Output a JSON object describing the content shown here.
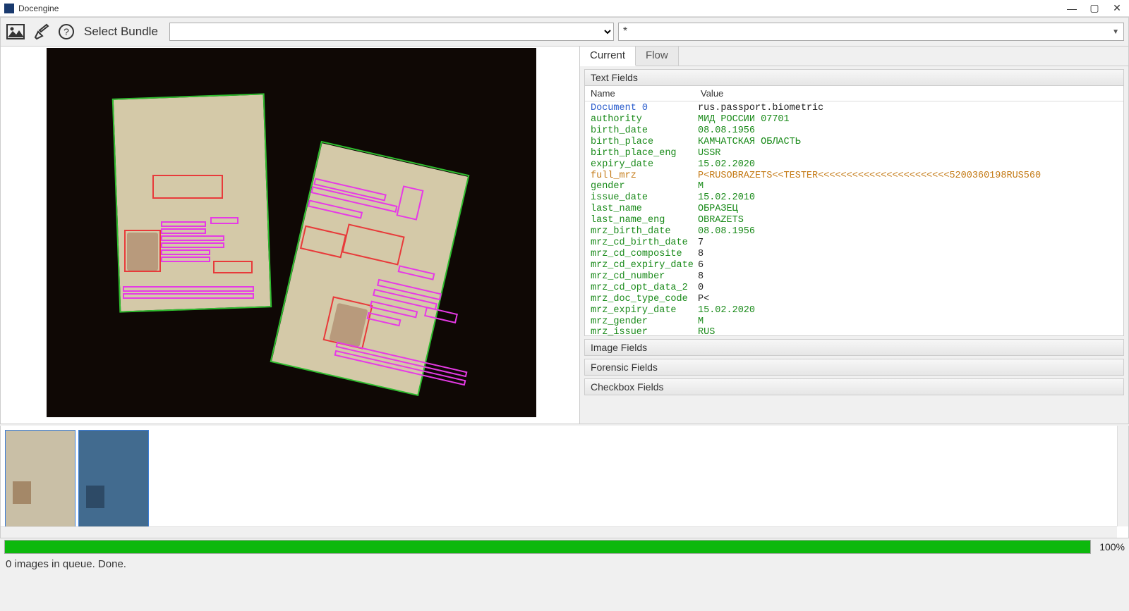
{
  "window": {
    "title": "Docengine"
  },
  "toolbar": {
    "select_bundle_label": "Select Bundle",
    "star_field": "*"
  },
  "tabs": {
    "current": "Current",
    "flow": "Flow"
  },
  "sections": {
    "text_fields": "Text Fields",
    "image_fields": "Image Fields",
    "forensic_fields": "Forensic Fields",
    "checkbox_fields": "Checkbox Fields"
  },
  "columns": {
    "name": "Name",
    "value": "Value"
  },
  "fields": [
    {
      "name": "Document 0",
      "value": "rus.passport.biometric",
      "ncls": "c-doc",
      "vcls": "c-black"
    },
    {
      "name": "authority",
      "value": "МИД РОССИИ 07701",
      "ncls": "c-green",
      "vcls": "c-green"
    },
    {
      "name": "birth_date",
      "value": "08.08.1956",
      "ncls": "c-green",
      "vcls": "c-green"
    },
    {
      "name": "birth_place",
      "value": "КАМЧАТСКАЯ ОБЛАСТЬ",
      "ncls": "c-green",
      "vcls": "c-green"
    },
    {
      "name": "birth_place_eng",
      "value": "USSR",
      "ncls": "c-green",
      "vcls": "c-green"
    },
    {
      "name": "expiry_date",
      "value": "15.02.2020",
      "ncls": "c-green",
      "vcls": "c-green"
    },
    {
      "name": "full_mrz",
      "value": "P<RUSOBRAZETS<<TESTER<<<<<<<<<<<<<<<<<<<<<<<5200360198RUS560",
      "ncls": "c-orange",
      "vcls": "c-orange"
    },
    {
      "name": "gender",
      "value": "M",
      "ncls": "c-green",
      "vcls": "c-green"
    },
    {
      "name": "issue_date",
      "value": "15.02.2010",
      "ncls": "c-green",
      "vcls": "c-green"
    },
    {
      "name": "last_name",
      "value": "ОБРАЗЕЦ",
      "ncls": "c-green",
      "vcls": "c-green"
    },
    {
      "name": "last_name_eng",
      "value": "OBRAZETS",
      "ncls": "c-green",
      "vcls": "c-green"
    },
    {
      "name": "mrz_birth_date",
      "value": "08.08.1956",
      "ncls": "c-green",
      "vcls": "c-green"
    },
    {
      "name": "mrz_cd_birth_date",
      "value": "7",
      "ncls": "c-green",
      "vcls": "c-black"
    },
    {
      "name": "mrz_cd_composite",
      "value": "8",
      "ncls": "c-green",
      "vcls": "c-black"
    },
    {
      "name": "mrz_cd_expiry_date",
      "value": "6",
      "ncls": "c-green",
      "vcls": "c-black"
    },
    {
      "name": "mrz_cd_number",
      "value": "8",
      "ncls": "c-green",
      "vcls": "c-black"
    },
    {
      "name": "mrz_cd_opt_data_2",
      "value": "0",
      "ncls": "c-green",
      "vcls": "c-black"
    },
    {
      "name": "mrz_doc_type_code",
      "value": "P<",
      "ncls": "c-green",
      "vcls": "c-black"
    },
    {
      "name": "mrz_expiry_date",
      "value": "15.02.2020",
      "ncls": "c-green",
      "vcls": "c-green"
    },
    {
      "name": "mrz_gender",
      "value": "M",
      "ncls": "c-green",
      "vcls": "c-green"
    },
    {
      "name": "mrz_issuer",
      "value": "RUS",
      "ncls": "c-green",
      "vcls": "c-green"
    }
  ],
  "progress": {
    "pct": "100%"
  },
  "status": {
    "text": "0 images in queue. Done."
  }
}
